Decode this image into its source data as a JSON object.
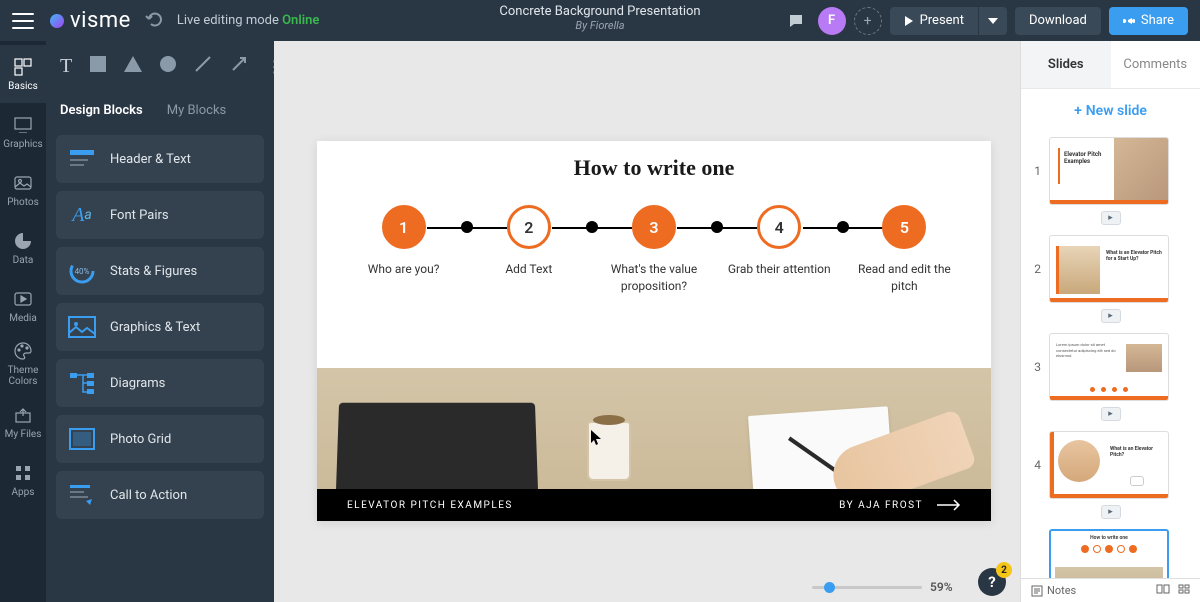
{
  "header": {
    "brand": "visme",
    "editing_mode_prefix": "Live editing mode ",
    "online": "Online",
    "title": "Concrete Background Presentation",
    "subtitle": "By Fiorella",
    "avatar_letter": "F",
    "present": "Present",
    "download": "Download",
    "share": "Share"
  },
  "rail": {
    "basics": "Basics",
    "graphics": "Graphics",
    "photos": "Photos",
    "data": "Data",
    "media": "Media",
    "theme_colors": "Theme Colors",
    "my_files": "My Files",
    "apps": "Apps"
  },
  "panel": {
    "tab_design": "Design Blocks",
    "tab_my": "My Blocks",
    "items": {
      "header_text": "Header & Text",
      "font_pairs": "Font Pairs",
      "stats_figures": "Stats & Figures",
      "graphics_text": "Graphics & Text",
      "diagrams": "Diagrams",
      "photo_grid": "Photo Grid",
      "call_to_action": "Call to Action"
    },
    "pct_icon": "40%"
  },
  "slide": {
    "title": "How to write one",
    "steps": [
      {
        "num": "1",
        "label": "Who are you?",
        "filled": true
      },
      {
        "num": "2",
        "label": "Add Text",
        "filled": false
      },
      {
        "num": "3",
        "label": "What's the value proposition?",
        "filled": true
      },
      {
        "num": "4",
        "label": "Grab their attention",
        "filled": false
      },
      {
        "num": "5",
        "label": "Read and edit the pitch",
        "filled": true
      }
    ],
    "footer_left": "ELEVATOR PITCH EXAMPLES",
    "footer_right": "BY AJA FROST"
  },
  "zoom": {
    "percent": "59%"
  },
  "help_badge": "2",
  "right": {
    "tab_slides": "Slides",
    "tab_comments": "Comments",
    "new_slide": "New slide",
    "thumbs": {
      "t1_title": "Elevator Pitch Examples",
      "t2_title": "What is an Elevator Pitch for a Start Up?",
      "t4_title": "What is an Elevator Pitch?",
      "t5_title": "How to write one"
    },
    "notes_label": "Notes"
  }
}
